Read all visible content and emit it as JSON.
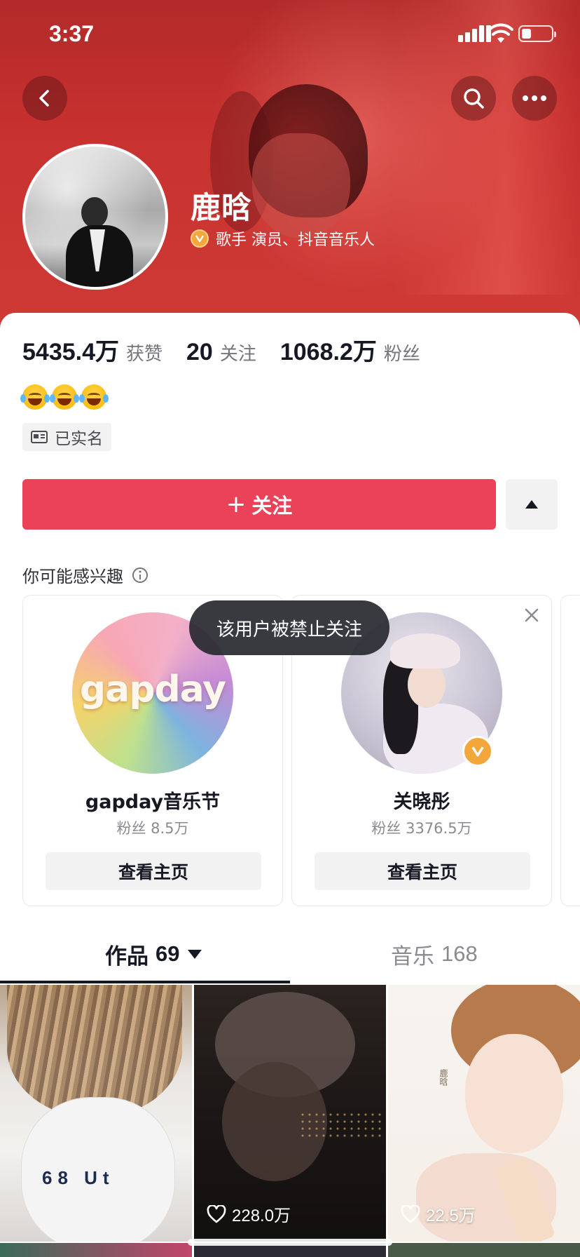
{
  "status_bar": {
    "time": "3:37"
  },
  "profile": {
    "name": "鹿晗",
    "verification": "歌手 演员、抖音音乐人",
    "stats": [
      {
        "value": "5435.4万",
        "label": "获赞"
      },
      {
        "value": "20",
        "label": "关注"
      },
      {
        "value": "1068.2万",
        "label": "粉丝"
      }
    ],
    "real_name_badge": "已实名",
    "follow_label": "关注"
  },
  "suggestions": {
    "title": "你可能感兴趣",
    "cards": [
      {
        "name": "gapday音乐节",
        "fans": "粉丝 8.5万",
        "button": "查看主页",
        "logo_text": "gapday"
      },
      {
        "name": "关晓彤",
        "fans": "粉丝 3376.5万",
        "button": "查看主页"
      }
    ]
  },
  "toast": "该用户被禁止关注",
  "tabs": [
    {
      "label": "作品",
      "count": "69"
    },
    {
      "label": "音乐",
      "count": "168"
    }
  ],
  "videos": [
    {
      "likes": "",
      "overlay_text": "68 Ut"
    },
    {
      "likes": "228.0万"
    },
    {
      "likes": "22.5万",
      "overlay_text": "鹿晗"
    }
  ],
  "colors": {
    "header_red": "#c7312f",
    "follow_button": "#ea4258",
    "verified_gold": "#f3a73a"
  }
}
